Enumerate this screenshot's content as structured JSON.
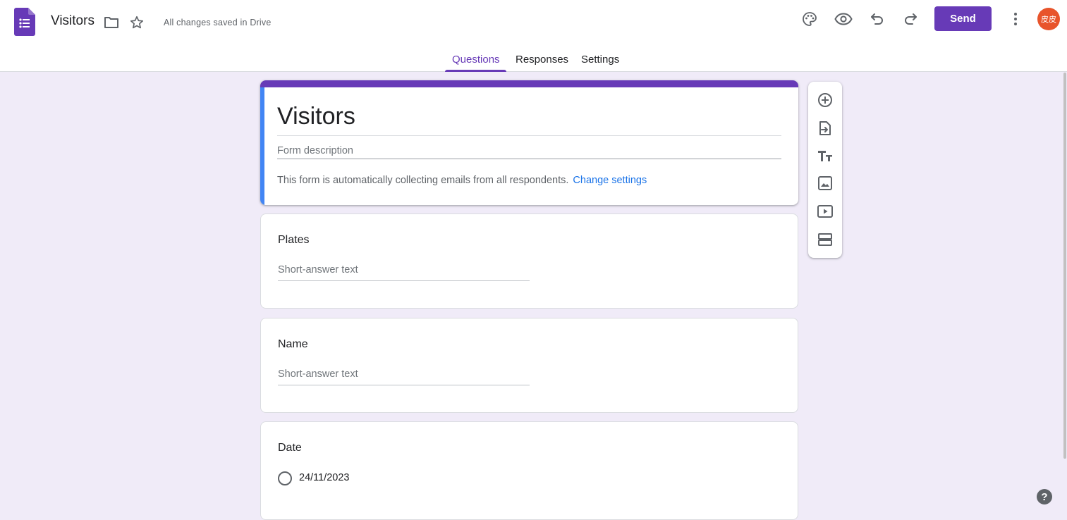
{
  "header": {
    "doc_title": "Visitors",
    "save_status": "All changes saved in Drive",
    "send_label": "Send",
    "avatar_text": "皮皮",
    "icons": [
      "forms-logo-icon",
      "folder-icon",
      "star-icon",
      "palette-icon",
      "eye-icon",
      "undo-icon",
      "redo-icon",
      "more-vert-icon"
    ]
  },
  "tabs": {
    "questions": "Questions",
    "responses": "Responses",
    "settings": "Settings",
    "active": "questions"
  },
  "form": {
    "title": "Visitors",
    "description_placeholder": "Form description",
    "email_note": "This form is automatically collecting emails from all respondents.",
    "change_settings": "Change settings"
  },
  "questions": [
    {
      "title": "Plates",
      "placeholder": "Short-answer text"
    },
    {
      "title": "Name",
      "placeholder": "Short-answer text"
    },
    {
      "title": "Date",
      "option": "24/11/2023"
    }
  ],
  "toolbar": [
    "add-question-icon",
    "import-questions-icon",
    "add-title-icon",
    "add-image-icon",
    "add-video-icon",
    "add-section-icon"
  ],
  "colors": {
    "accent": "#673ab7",
    "background": "#f0ebf8",
    "link": "#1a73e8",
    "card_left_bar": "#4285f4"
  }
}
